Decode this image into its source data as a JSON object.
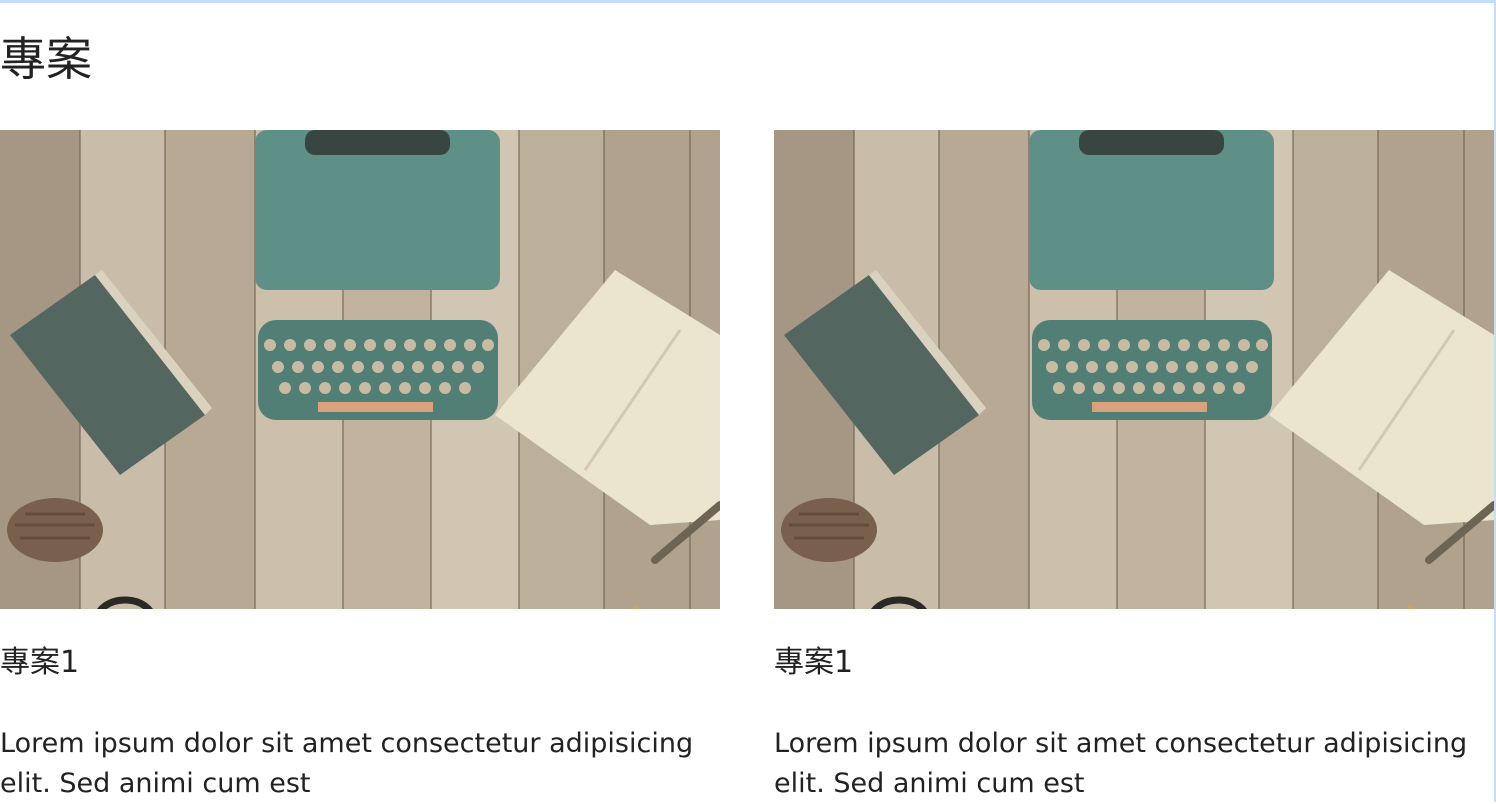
{
  "section": {
    "title": "專案"
  },
  "projects": [
    {
      "title": "專案1",
      "text": "Lorem ipsum dolor sit amet consectetur adipisicing elit. Sed animi cum est",
      "image": "workspace-photo"
    },
    {
      "title": "專案1",
      "text": "Lorem ipsum dolor sit amet consectetur adipisicing elit. Sed animi cum est",
      "image": "workspace-photo"
    }
  ]
}
